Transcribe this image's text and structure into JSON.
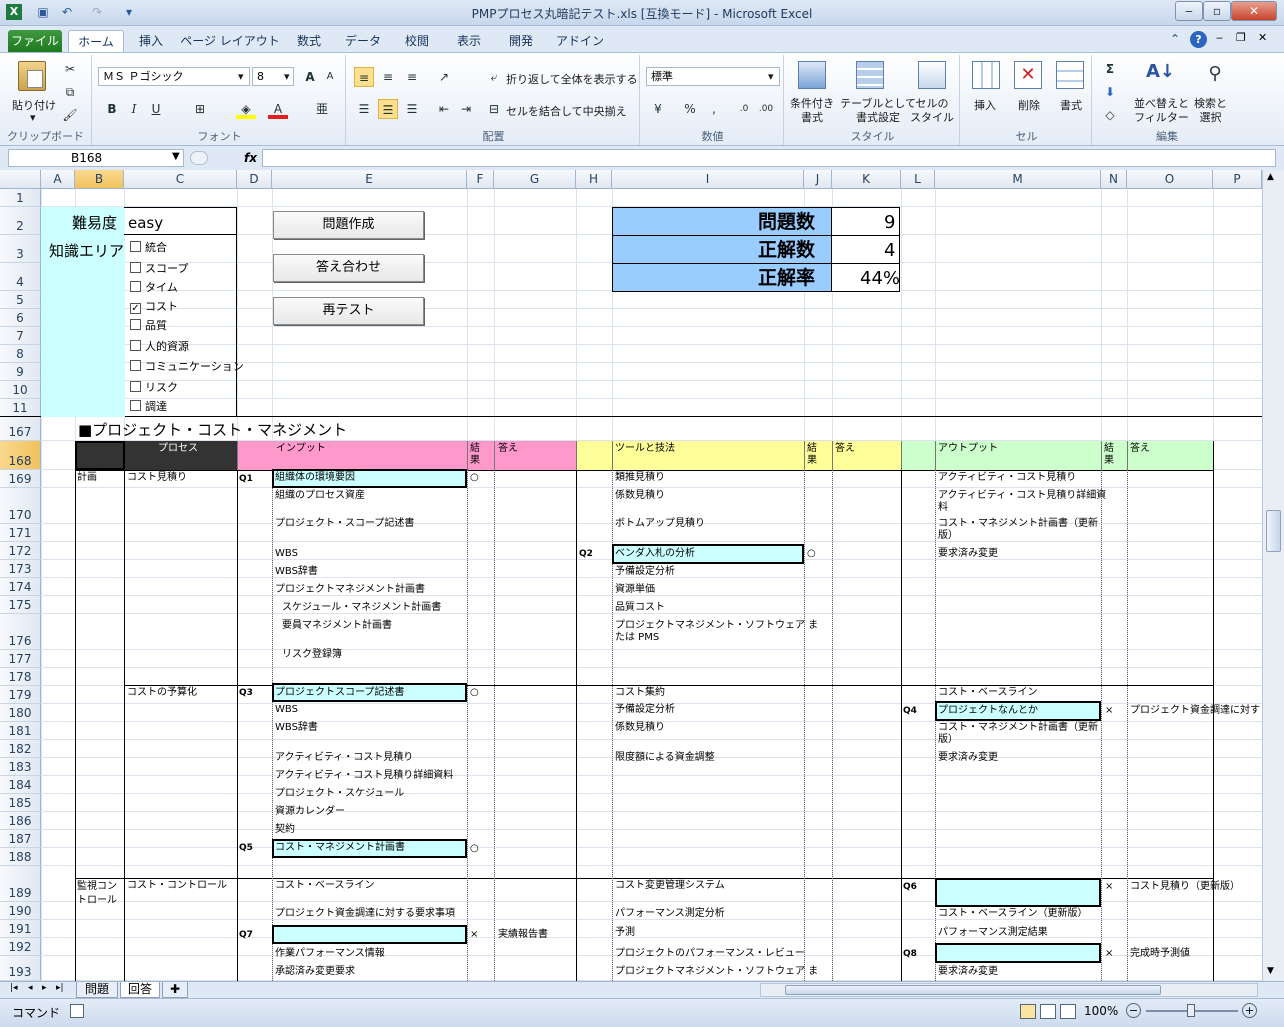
{
  "window": {
    "title": "PMPプロセス丸暗記テスト.xls  [互換モード] - Microsoft Excel"
  },
  "tabs": [
    "ファイル",
    "ホーム",
    "挿入",
    "ページ レイアウト",
    "数式",
    "データ",
    "校閲",
    "表示",
    "開発",
    "アドイン"
  ],
  "ribbon": {
    "clipboard": {
      "paste": "貼り付け",
      "label": "クリップボード"
    },
    "font": {
      "name": "ＭＳ Ｐゴシック",
      "size": "8",
      "label": "フォント"
    },
    "alignment": {
      "wrap": "折り返して全体を表示する",
      "merge": "セルを結合して中央揃え",
      "label": "配置"
    },
    "number": {
      "format": "標準",
      "label": "数値"
    },
    "styles": {
      "conditional": "条件付き\n書式",
      "table": "テーブルとして\n書式設定",
      "cell": "セルの\nスタイル",
      "label": "スタイル"
    },
    "cells": {
      "insert": "挿入",
      "delete": "削除",
      "format": "書式",
      "label": "セル"
    },
    "editing": {
      "sort": "並べ替えと\nフィルター",
      "find": "検索と\n選択",
      "label": "編集"
    }
  },
  "formula": {
    "name_box": "B168",
    "fx": "fx",
    "value": ""
  },
  "columns": [
    "A",
    "B",
    "C",
    "D",
    "E",
    "F",
    "G",
    "H",
    "I",
    "J",
    "K",
    "L",
    "M",
    "N",
    "O",
    "P"
  ],
  "rows_top": [
    "1",
    "2",
    "3",
    "4",
    "5",
    "6",
    "7",
    "8",
    "9",
    "10",
    "11"
  ],
  "rows_bottom": [
    "167",
    "168",
    "169",
    "170",
    "171",
    "172",
    "173",
    "174",
    "175",
    "176",
    "177",
    "178",
    "179",
    "180",
    "181",
    "182",
    "183",
    "184",
    "185",
    "186",
    "187",
    "188",
    "189",
    "190",
    "191",
    "192",
    "193"
  ],
  "settings": {
    "difficulty_label": "難易度",
    "difficulty_value": "easy",
    "area_label": "知識エリア",
    "areas": [
      {
        "name": "統合",
        "checked": false
      },
      {
        "name": "スコープ",
        "checked": false
      },
      {
        "name": "タイム",
        "checked": false
      },
      {
        "name": "コスト",
        "checked": true
      },
      {
        "name": "品質",
        "checked": false
      },
      {
        "name": "人的資源",
        "checked": false
      },
      {
        "name": "コミュニケーション",
        "checked": false
      },
      {
        "name": "リスク",
        "checked": false
      },
      {
        "name": "調達",
        "checked": false
      }
    ]
  },
  "buttons": {
    "create": "問題作成",
    "check": "答え合わせ",
    "retest": "再テスト"
  },
  "score": {
    "q_label": "問題数",
    "q_value": "9",
    "c_label": "正解数",
    "c_value": "4",
    "r_label": "正解率",
    "r_value": "44%"
  },
  "section_title": "■プロジェクト・コスト・マネジメント",
  "header": {
    "process": "プロセス",
    "input": "インプット",
    "result": "結\n果",
    "answer": "答え",
    "tools": "ツールと技法",
    "output": "アウトプット"
  },
  "blocks": [
    {
      "group": "計画",
      "process": "コスト見積り"
    },
    {
      "group": "",
      "process": "コストの予算化"
    },
    {
      "group": "監視コン\nトロール",
      "process": "コスト・コントロール"
    }
  ],
  "cells": {
    "q1": "Q1",
    "q2": "Q2",
    "q3": "Q3",
    "q4": "Q4",
    "q5": "Q5",
    "q6": "Q6",
    "q7": "Q7",
    "q8": "Q8",
    "in1": [
      "組織体の環境要因",
      "組織のプロセス資産",
      "プロジェクト・スコープ記述書",
      "WBS",
      "WBS辞書",
      "プロジェクトマネジメント計画書",
      "スケジュール・マネジメント計画書",
      "要員マネジメント計画書",
      "リスク登録簿"
    ],
    "tl1": [
      "類推見積り",
      "係数見積り",
      "ボトムアップ見積り",
      "ベンダ入札の分析",
      "予備設定分析",
      "資源単価",
      "品質コスト",
      "プロジェクトマネジメント・ソフトウェア ま\nたは PMS"
    ],
    "out1": [
      "アクティビティ・コスト見積り",
      "アクティビティ・コスト見積り詳細資\n料",
      "コスト・マネジメント計画書（更新\n版）",
      "要求済み変更"
    ],
    "in2": [
      "プロジェクトスコープ記述書",
      "WBS",
      "WBS辞書",
      "アクティビティ・コスト見積り",
      "アクティビティ・コスト見積り詳細資料",
      "プロジェクト・スケジュール",
      "資源カレンダー",
      "契約",
      "コスト・マネジメント計画書"
    ],
    "tl2": [
      "コスト集約",
      "予備設定分析",
      "係数見積り",
      "限度額による資金調整"
    ],
    "out2": [
      "コスト・ベースライン",
      "プロジェクトなんとか",
      "コスト・マネジメント計画書（更新\n版）",
      "要求済み変更"
    ],
    "ans_q4": "プロジェクト資金調達に対す",
    "in3": [
      "コスト・ベースライン",
      "プロジェクト資金調達に対する要求事項",
      "",
      "作業パフォーマンス情報",
      "承認済み変更要求"
    ],
    "tl3": [
      "コスト変更管理システム",
      "パフォーマンス測定分析",
      "予測",
      "プロジェクトのパフォーマンス・レビュー",
      "プロジェクトマネジメント・ソフトウェア ま"
    ],
    "out3": [
      "",
      "コスト・ベースライン（更新版）",
      "パフォーマンス測定結果",
      "",
      "要求済み変更"
    ],
    "ans_q6": "コスト見積り（更新版）",
    "ans_q7": "実績報告書",
    "ans_q8": "完成時予測値",
    "mark_ok": "○",
    "mark_ng": "×"
  },
  "sheets": [
    "問題",
    "回答"
  ],
  "status": {
    "mode": "コマンド",
    "zoom": "100%"
  }
}
